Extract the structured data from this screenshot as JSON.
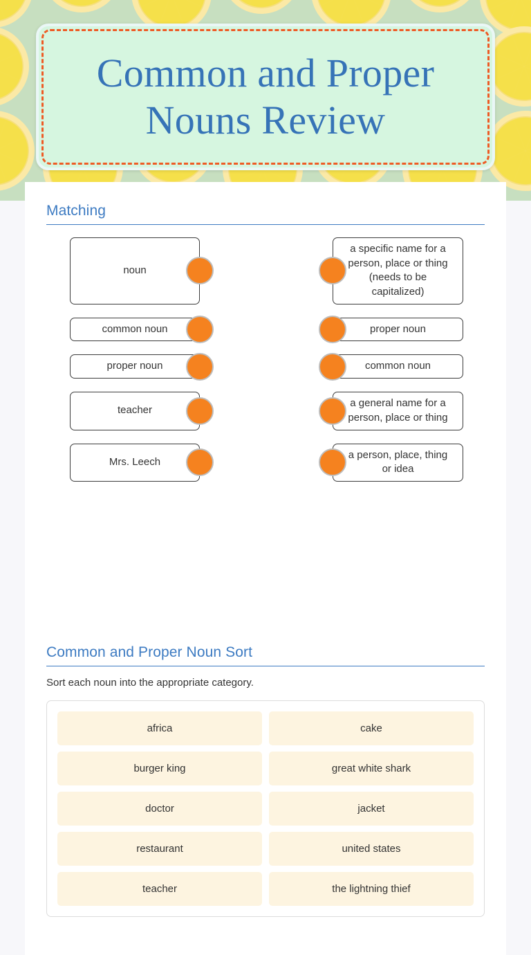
{
  "worksheet": {
    "title": "Common and Proper Nouns Review",
    "theme": {
      "title_text_color": "#3673b7",
      "title_fill": "#d6f6e0",
      "title_border": "#ee5b25",
      "heading_color": "#3d7bc2",
      "dot_color": "#f5821f",
      "tile_color": "#fdf4e0",
      "background_pattern": "lemon-slices",
      "background_color": "#c7dfc0"
    }
  },
  "matching": {
    "heading": "Matching",
    "pairs": [
      {
        "left": "noun",
        "right": "a specific name for a person, place or thing (needs to be capitalized)"
      },
      {
        "left": "common noun",
        "right": "proper noun"
      },
      {
        "left": "proper noun",
        "right": "common noun"
      },
      {
        "left": "teacher",
        "right": "a general name for a person, place or thing"
      },
      {
        "left": "Mrs. Leech",
        "right": "a person, place, thing or idea"
      }
    ]
  },
  "sort": {
    "heading": "Common and Proper Noun Sort",
    "instructions": "Sort each noun into the appropriate category.",
    "words": [
      "africa",
      "cake",
      "burger king",
      "great white shark",
      "doctor",
      "jacket",
      "restaurant",
      "united states",
      "teacher",
      "the lightning thief"
    ]
  }
}
